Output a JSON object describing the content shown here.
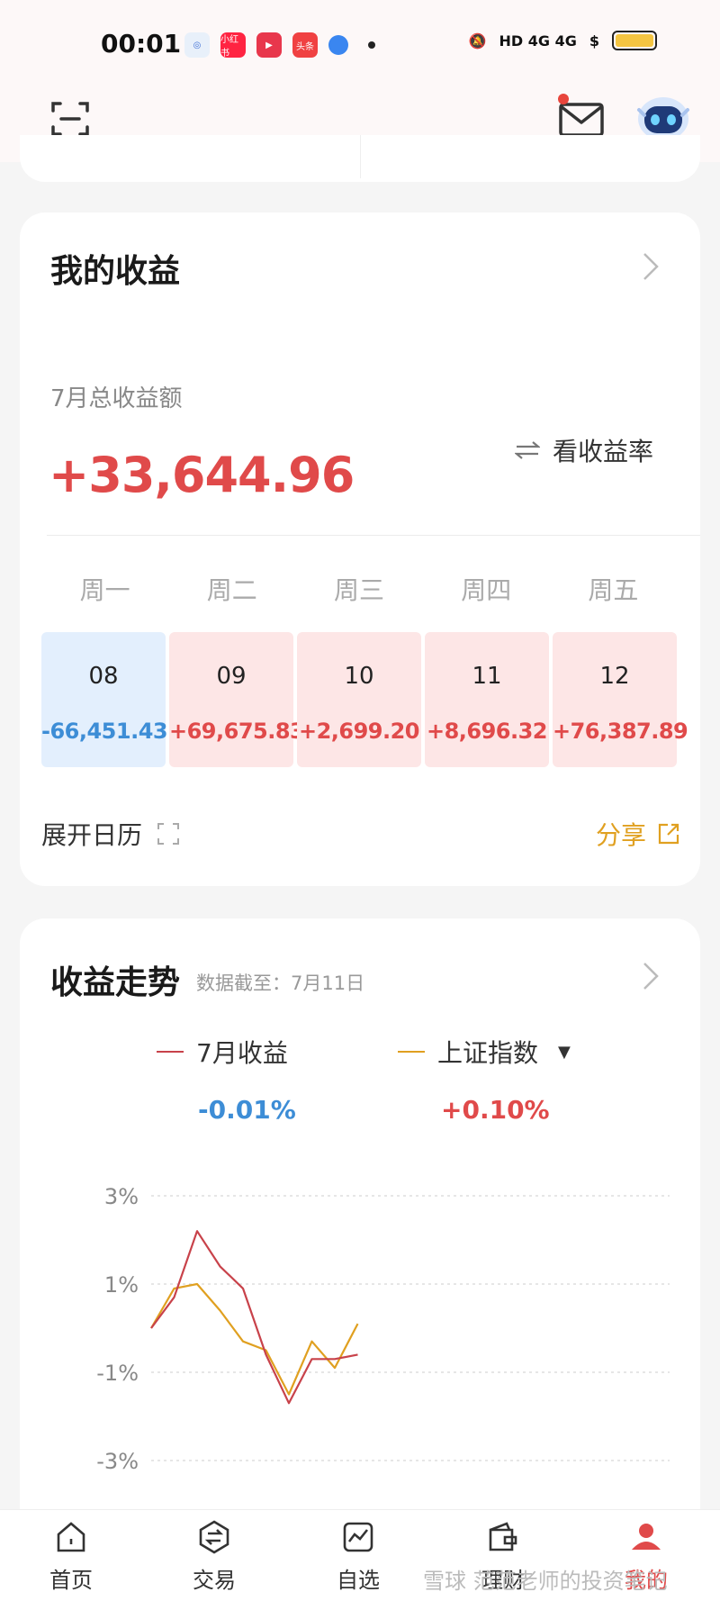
{
  "status_bar": {
    "time": "00:01",
    "signal": "HD 4G 4G",
    "apps": [
      "小红书",
      "头条"
    ]
  },
  "colors": {
    "up": "#e04a4a",
    "down": "#3d8dd6",
    "index": "#e0a020",
    "accent": "#e04a4a"
  },
  "earnings": {
    "title": "我的收益",
    "month_label": "7月总收益额",
    "month_total": "+33,644.96",
    "rate_toggle": "看收益率",
    "weekdays": [
      "周一",
      "周二",
      "周三",
      "周四",
      "周五"
    ],
    "days": [
      {
        "date": "08",
        "value": "-66,451.43"
      },
      {
        "date": "09",
        "value": "+69,675.83"
      },
      {
        "date": "10",
        "value": "+2,699.20"
      },
      {
        "date": "11",
        "value": "+8,696.32"
      },
      {
        "date": "12",
        "value": "+76,387.89"
      }
    ],
    "expand_label": "展开日历",
    "share_label": "分享"
  },
  "trend": {
    "title": "收益走势",
    "subtitle": "数据截至：7月11日",
    "legend": [
      {
        "name": "7月收益",
        "value": "-0.01%"
      },
      {
        "name": "上证指数",
        "value": "+0.10%"
      }
    ]
  },
  "chart_data": {
    "type": "line",
    "y_ticks": [
      "3%",
      "1%",
      "-1%",
      "-3%"
    ],
    "ylim": [
      -3,
      3
    ],
    "grid": true,
    "series": [
      {
        "name": "7月收益",
        "color": "#c8424a",
        "values": [
          0.0,
          0.7,
          2.2,
          1.4,
          0.9,
          -0.6,
          -1.7,
          -0.7,
          -0.7,
          -0.6
        ]
      },
      {
        "name": "上证指数",
        "color": "#e0a020",
        "values": [
          0.0,
          0.9,
          1.0,
          0.4,
          -0.3,
          -0.5,
          -1.5,
          -0.3,
          -0.9,
          0.1
        ]
      }
    ]
  },
  "tabbar": {
    "tabs": [
      "首页",
      "交易",
      "自选",
      "理财",
      "我的"
    ],
    "active": "我的"
  },
  "watermark": "雪球 范范老师的投资笔记"
}
